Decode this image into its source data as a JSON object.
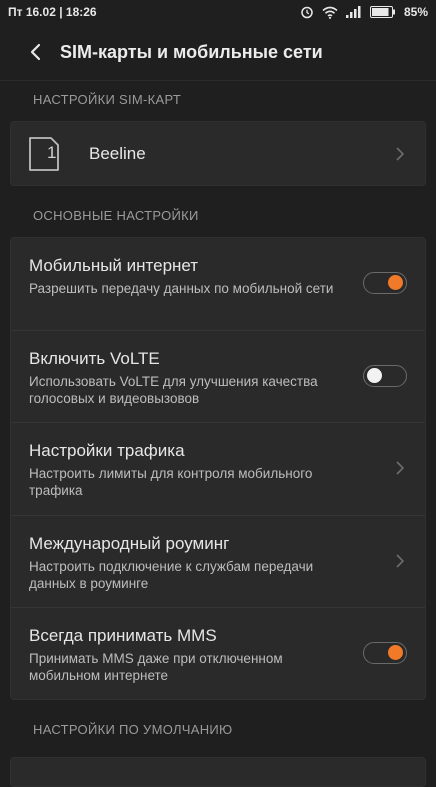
{
  "status": {
    "datetime": "Пт 16.02 | 18:26",
    "battery": "85%",
    "icons": [
      "alarm-icon",
      "wifi-icon",
      "signal-icon",
      "battery-icon"
    ]
  },
  "header": {
    "title": "SIM-карты и мобильные сети"
  },
  "sections": {
    "sim": "НАСТРОЙКИ SIM-КАРТ",
    "main": "ОСНОВНЫЕ НАСТРОЙКИ",
    "defaults": "НАСТРОЙКИ ПО УМОЛЧАНИЮ"
  },
  "sim": {
    "slot": "1",
    "name": "Beeline"
  },
  "settings": [
    {
      "title": "Мобильный интернет",
      "subtitle": "Разрешить передачу данных по мобильной сети",
      "control": "toggle",
      "state": "on"
    },
    {
      "title": "Включить VoLTE",
      "subtitle": "Использовать VoLTE для улучшения качества голосовых и видеовызовов",
      "control": "toggle",
      "state": "off"
    },
    {
      "title": "Настройки трафика",
      "subtitle": "Настроить лимиты для контроля мобильного трафика",
      "control": "chevron"
    },
    {
      "title": "Международный роуминг",
      "subtitle": "Настроить подключение к службам передачи данных в роуминге",
      "control": "chevron"
    },
    {
      "title": "Всегда принимать MMS",
      "subtitle": "Принимать MMS даже при отключенном мобильном интернете",
      "control": "toggle",
      "state": "on"
    }
  ],
  "colors": {
    "accent": "#f07a28",
    "background": "#1f1f1f",
    "card": "#2a2a2a"
  }
}
